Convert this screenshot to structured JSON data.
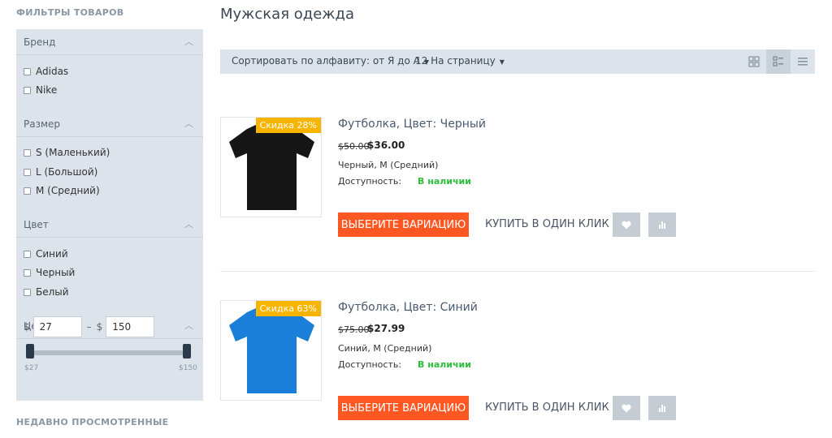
{
  "sidebar": {
    "filters_title": "ФИЛЬТРЫ ТОВАРОВ",
    "brand": {
      "title": "Бренд",
      "options": [
        "Adidas",
        "Nike"
      ]
    },
    "size": {
      "title": "Размер",
      "options": [
        "S (Маленький)",
        "L (Большой)",
        "M (Средний)"
      ]
    },
    "color": {
      "title": "Цвет",
      "options": [
        "Синий",
        "Черный",
        "Белый"
      ]
    },
    "price": {
      "title": "Цена",
      "currency": "$",
      "dash": "–",
      "min_value": "27",
      "max_value": "150",
      "slider_min_label": "$27",
      "slider_max_label": "$150"
    },
    "recent_title": "НЕДАВНО ПРОСМОТРЕННЫЕ"
  },
  "main": {
    "title": "Мужская одежда",
    "toolbar": {
      "sort_label": "Сортировать по алфавиту: от Я до А",
      "per_page_label": "12 На страницу",
      "active_view": "list-grid"
    },
    "products": [
      {
        "badge": "Скидка 28%",
        "name": "Футболка, Цвет: Черный",
        "old_price": "$50.00",
        "new_price": "$36.00",
        "variant": "Черный, M (Средний)",
        "availability_label": "Доступность:",
        "availability_value": "В наличии",
        "shirt_color": "#161616",
        "choose_label": "ВЫБЕРИТЕ ВАРИАЦИЮ",
        "one_click_label": "КУПИТЬ В ОДИН КЛИК"
      },
      {
        "badge": "Скидка 63%",
        "name": "Футболка, Цвет: Синий",
        "old_price": "$75.00",
        "new_price": "$27.99",
        "variant": "Синий, M (Средний)",
        "availability_label": "Доступность:",
        "availability_value": "В наличии",
        "shirt_color": "#1a7fd8",
        "choose_label": "ВЫБЕРИТЕ ВАРИАЦИЮ",
        "one_click_label": "КУПИТЬ В ОДИН КЛИК"
      }
    ]
  },
  "colors": {
    "accent": "#ff5722",
    "badge": "#f7b500",
    "in_stock": "#2ebd3d",
    "panel": "#dde3ea"
  },
  "icons": [
    "chevron-up-icon",
    "caret-down-icon",
    "grid-view-icon",
    "list-grid-view-icon",
    "list-view-icon",
    "heart-icon",
    "compare-icon"
  ]
}
